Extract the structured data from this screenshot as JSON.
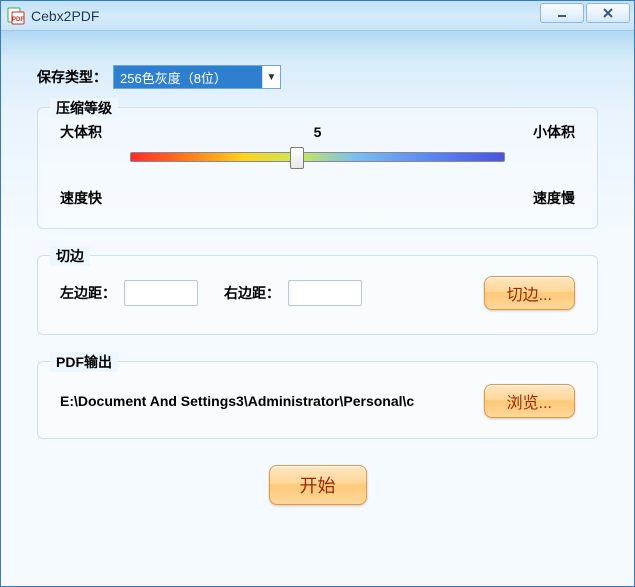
{
  "window": {
    "title": "Cebx2PDF"
  },
  "save": {
    "label": "保存类型：",
    "selected": "256色灰度（8位）"
  },
  "compression": {
    "legend": "压缩等级",
    "left_top": "大体积",
    "right_top": "小体积",
    "left_bottom": "速度快",
    "right_bottom": "速度慢",
    "value_text": "5",
    "value": 5,
    "min": 1,
    "max": 10
  },
  "trim": {
    "legend": "切边",
    "left_label": "左边距：",
    "right_label": "右边距：",
    "left_value": "",
    "right_value": "",
    "button": "切边..."
  },
  "output": {
    "legend": "PDF输出",
    "path": "E:\\Document And Settings3\\Administrator\\Personal\\c",
    "browse": "浏览..."
  },
  "start": {
    "label": "开始"
  }
}
